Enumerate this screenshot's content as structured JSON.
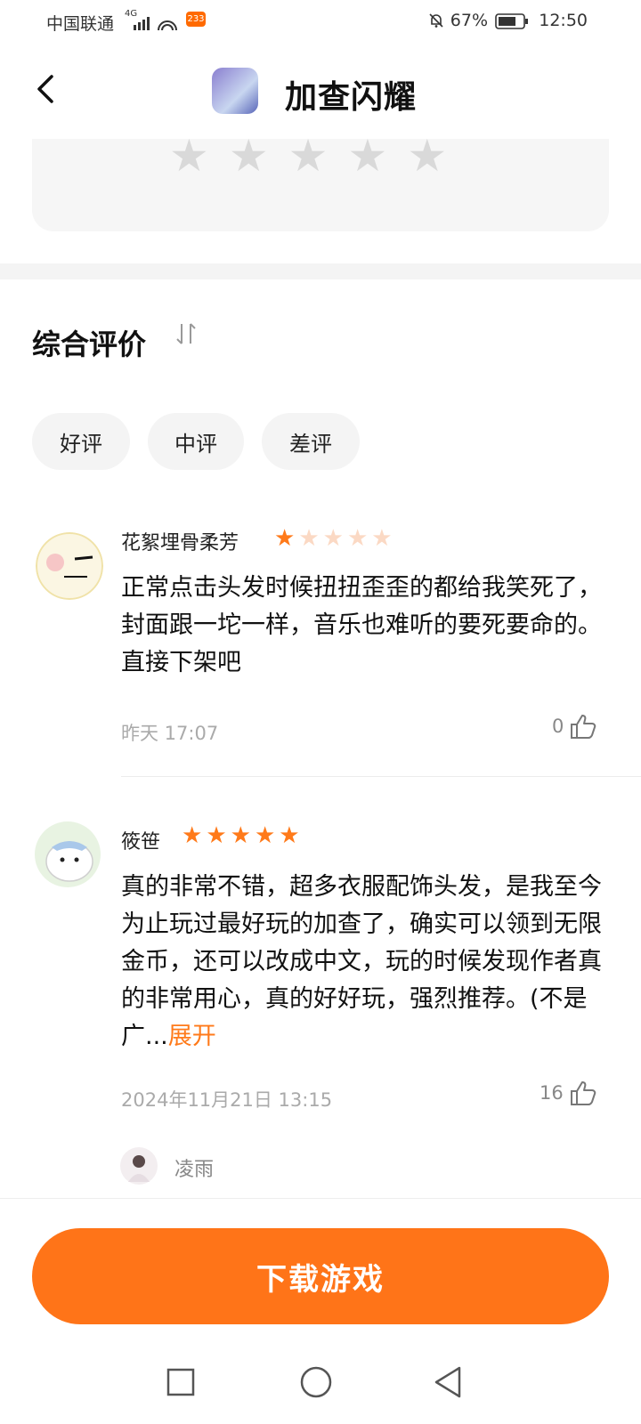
{
  "status": {
    "carrier": "中国联通",
    "network": "4G",
    "badge": "233",
    "battery": "67%",
    "time": "12:50"
  },
  "header": {
    "title": "加查闪耀"
  },
  "rating_input": {
    "stars_filled": 0,
    "stars_total": 5
  },
  "reviews_section": {
    "title": "综合评价",
    "filters": [
      "好评",
      "中评",
      "差评"
    ]
  },
  "reviews": [
    {
      "name": "花絮埋骨柔芳",
      "rating": 1,
      "text": "正常点击头发时候扭扭歪歪的都给我笑死了，封面跟一坨一样，音乐也难听的要死要命的。直接下架吧",
      "time": "昨天 17:07",
      "likes": "0"
    },
    {
      "name": "筱笹",
      "rating": 5,
      "text": "真的非常不错，超多衣服配饰头发，是我至今为止玩过最好玩的加查了，确实可以领到无限金币，还可以改成中文，玩的时候发现作者真的非常用心，真的好好玩，强烈推荐。(不是广...",
      "expand": "展开",
      "time": "2024年11月21日 13:15",
      "likes": "16",
      "reply_user": "凌雨"
    }
  ],
  "download_button": "下载游戏",
  "colors": {
    "accent": "#ff7418",
    "star_active": "#ff7a1a",
    "star_inactive": "#d9d9d9"
  }
}
